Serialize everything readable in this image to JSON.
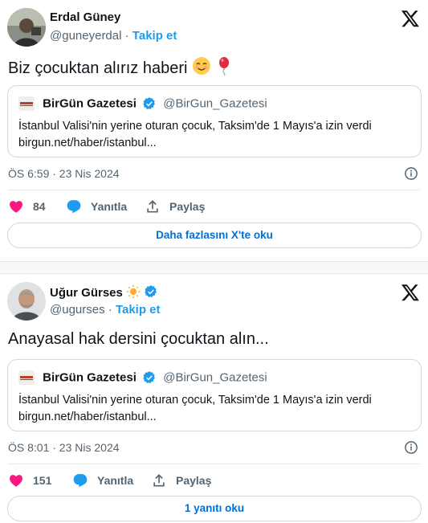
{
  "tweets": [
    {
      "author": "Erdal Güney",
      "handle": "@guneyerdal",
      "separator": "·",
      "follow_label": "Takip et",
      "text": "Biz çocuktan alırız haberi",
      "text_emojis": [
        "smiling-face-icon",
        "balloon-icon"
      ],
      "quote": {
        "source_name": "BirGün Gazetesi",
        "source_handle": "@BirGun_Gazetesi",
        "line1": "İstanbul Valisi'nin yerine oturan çocuk, Taksim'de 1 Mayıs'a izin verdi",
        "line2": "birgun.net/haber/istanbul..."
      },
      "time": "ÖS 6:59 · 23 Nis 2024",
      "likes": "84",
      "reply_label": "Yanıtla",
      "share_label": "Paylaş",
      "read_more_label": "Daha fazlasını X'te oku"
    },
    {
      "author": "Uğur Gürses",
      "author_emoji": "sun-icon",
      "verified": true,
      "handle": "@ugurses",
      "separator": "·",
      "follow_label": "Takip et",
      "text": "Anayasal hak dersini çocuktan alın...",
      "quote": {
        "source_name": "BirGün Gazetesi",
        "source_handle": "@BirGun_Gazetesi",
        "line1": "İstanbul Valisi'nin yerine oturan çocuk, Taksim'de 1 Mayıs'a izin verdi",
        "line2": "birgun.net/haber/istanbul..."
      },
      "time": "ÖS 8:01 · 23 Nis 2024",
      "likes": "151",
      "reply_label": "Yanıtla",
      "share_label": "Paylaş",
      "read_more_label": "1 yanıtı oku"
    }
  ],
  "colors": {
    "accent": "#1d9bf0",
    "like": "#f91880",
    "muted": "#536471",
    "link_text": "#006fd6"
  }
}
